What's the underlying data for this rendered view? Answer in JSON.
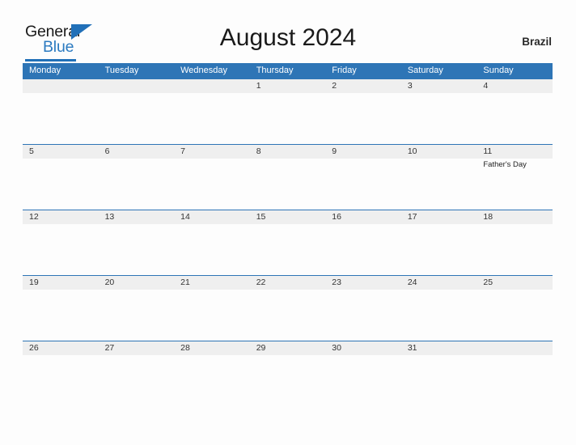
{
  "branding": {
    "logo_word_1": "General",
    "logo_word_2": "Blue",
    "logo_flag_icon": "triangle-flag-icon",
    "brand_color": "#2170b8"
  },
  "header": {
    "title": "August 2024",
    "country": "Brazil"
  },
  "calendar": {
    "header_bg": "#2e75b6",
    "date_band_bg": "#efefef",
    "weekdays": [
      "Monday",
      "Tuesday",
      "Wednesday",
      "Thursday",
      "Friday",
      "Saturday",
      "Sunday"
    ],
    "weeks": [
      {
        "dates": [
          "",
          "",
          "",
          "1",
          "2",
          "3",
          "4"
        ],
        "events": [
          "",
          "",
          "",
          "",
          "",
          "",
          ""
        ]
      },
      {
        "dates": [
          "5",
          "6",
          "7",
          "8",
          "9",
          "10",
          "11"
        ],
        "events": [
          "",
          "",
          "",
          "",
          "",
          "",
          "Father's Day"
        ]
      },
      {
        "dates": [
          "12",
          "13",
          "14",
          "15",
          "16",
          "17",
          "18"
        ],
        "events": [
          "",
          "",
          "",
          "",
          "",
          "",
          ""
        ]
      },
      {
        "dates": [
          "19",
          "20",
          "21",
          "22",
          "23",
          "24",
          "25"
        ],
        "events": [
          "",
          "",
          "",
          "",
          "",
          "",
          ""
        ]
      },
      {
        "dates": [
          "26",
          "27",
          "28",
          "29",
          "30",
          "31",
          ""
        ],
        "events": [
          "",
          "",
          "",
          "",
          "",
          "",
          ""
        ]
      }
    ]
  }
}
